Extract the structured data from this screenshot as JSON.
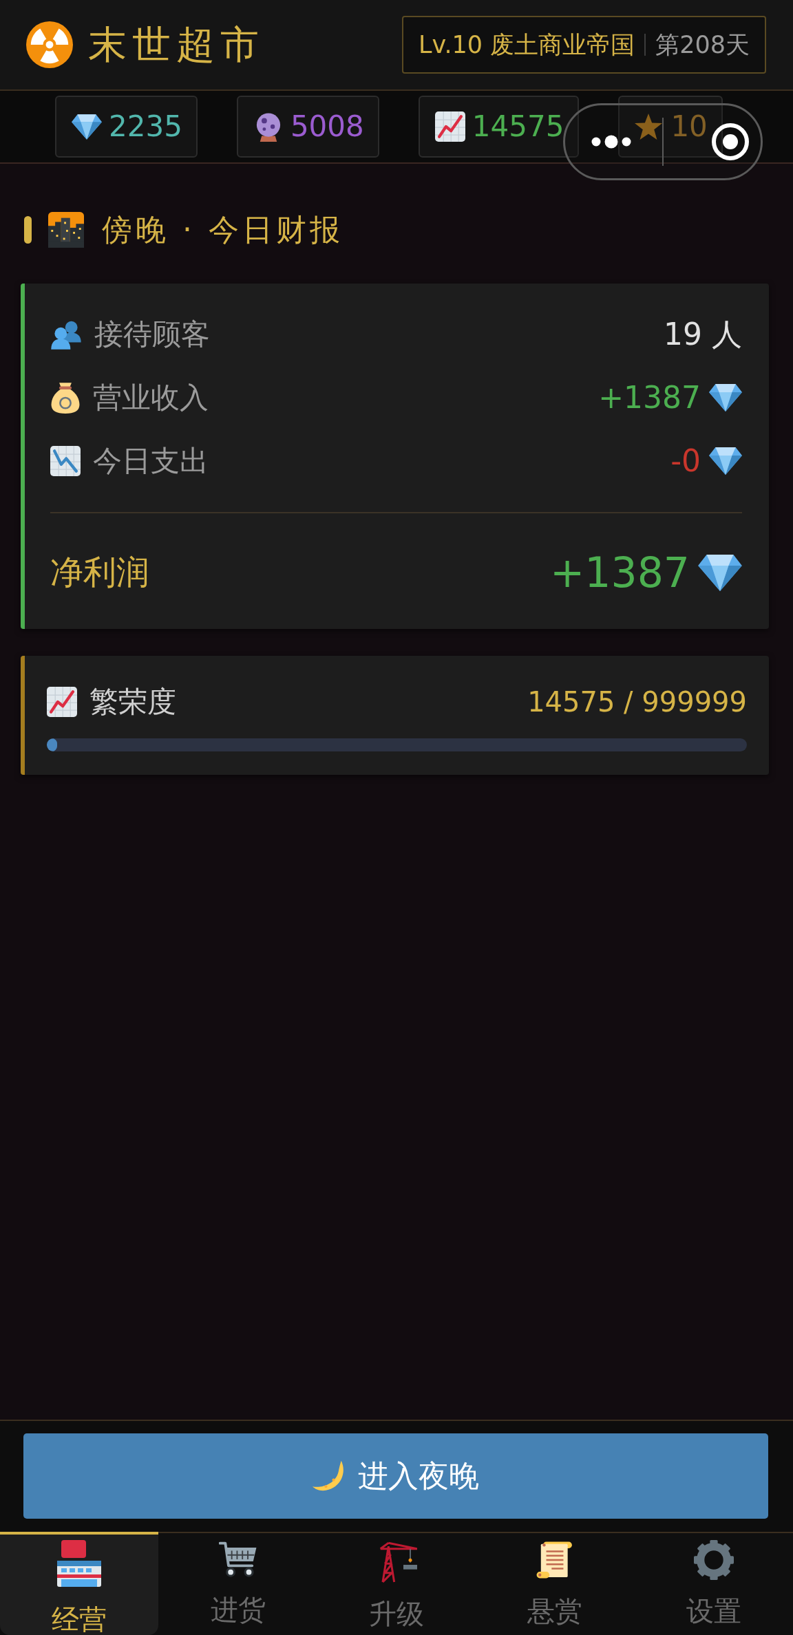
{
  "header": {
    "title": "末世超市",
    "level": "Lv.10 废土商业帝国",
    "day": "第208天"
  },
  "resources": [
    {
      "kind": "diamond",
      "value": "2235"
    },
    {
      "kind": "orb",
      "value": "5008"
    },
    {
      "kind": "prosperity",
      "value": "14575"
    },
    {
      "kind": "star",
      "value": "10"
    }
  ],
  "section_title": "傍晚 · 今日财报",
  "report": {
    "rows": [
      {
        "kind": "customers",
        "label": "接待顾客",
        "value": "19 人"
      },
      {
        "kind": "income",
        "label": "营业收入",
        "value": "+1387"
      },
      {
        "kind": "expense",
        "label": "今日支出",
        "value": "-0"
      }
    ],
    "net": {
      "label": "净利润",
      "value": "+1387"
    }
  },
  "prosperity": {
    "label": "繁荣度",
    "reading": "14575 / 999999",
    "level": 0.0146
  },
  "action_button": {
    "label": "进入夜晚"
  },
  "tabs": [
    {
      "kind": "store",
      "label": "经营",
      "selected": true
    },
    {
      "kind": "cart",
      "label": "进货",
      "selected": false
    },
    {
      "kind": "crane",
      "label": "升级",
      "selected": false
    },
    {
      "kind": "scroll",
      "label": "悬赏",
      "selected": false
    },
    {
      "kind": "gear",
      "label": "设置",
      "selected": false
    }
  ]
}
